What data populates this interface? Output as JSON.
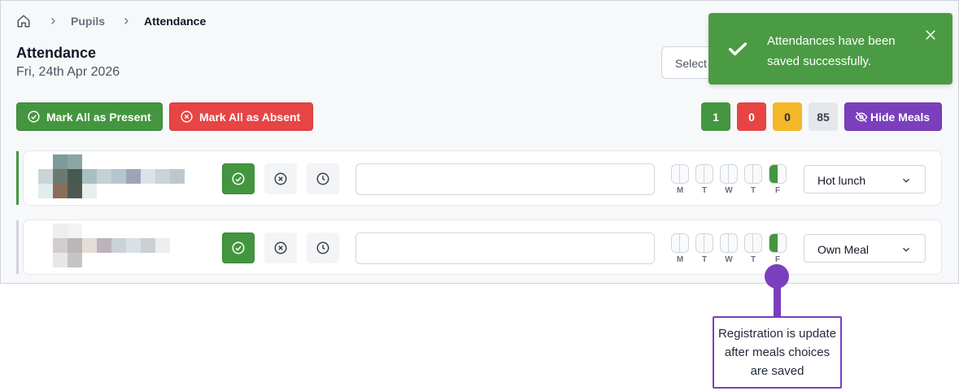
{
  "breadcrumb": {
    "home_icon": "home-icon",
    "items": [
      "Pupils",
      "Attendance"
    ]
  },
  "header": {
    "title": "Attendance",
    "date": "Fri, 24th Apr 2026"
  },
  "filter": {
    "label": "Select"
  },
  "actions": {
    "mark_present": "Mark All as Present",
    "mark_absent": "Mark All as Absent",
    "hide_meals": "Hide Meals"
  },
  "counts": {
    "present": "1",
    "absent": "0",
    "late": "0",
    "unmarked": "85"
  },
  "colors": {
    "green": "#43963f",
    "red": "#e74444",
    "yellow": "#f3b728",
    "purple": "#7b3fbd"
  },
  "days": [
    "M",
    "T",
    "W",
    "T",
    "F"
  ],
  "pupils": [
    {
      "status": "present",
      "meal": "Hot lunch",
      "registered_days": [
        false,
        false,
        false,
        false,
        true
      ]
    },
    {
      "status": "present",
      "meal": "Own Meal",
      "registered_days": [
        false,
        false,
        false,
        false,
        true
      ]
    }
  ],
  "toast": {
    "message": "Attendances have been saved successfully."
  },
  "annotation": {
    "text": "Registration is update after meals choices are saved"
  }
}
